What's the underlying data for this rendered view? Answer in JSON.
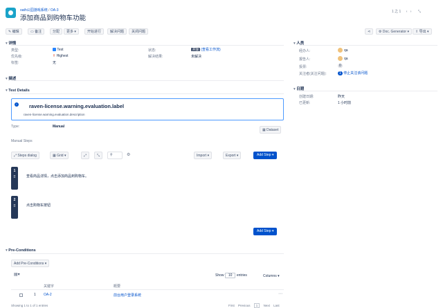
{
  "header": {
    "breadcrumb_project": "oath公园游戏系统",
    "breadcrumb_sep": "/",
    "breadcrumb_issue": "OA-3",
    "title": "添加商品到购物车功能",
    "pager": "1 之 1"
  },
  "toolbar": {
    "edit": "编辑",
    "comment": "备注",
    "assign": "分配",
    "more": "更多",
    "start": "开始进行",
    "resolve": "解决问题",
    "close": "关闭问题",
    "doc_generator": "Doc. Generator",
    "export": "导出"
  },
  "details": {
    "title": "详情",
    "type_label": "类型:",
    "type_value": "Test",
    "priority_label": "优先级:",
    "priority_value": "Highest",
    "tags_label": "标签:",
    "tags_value": "无",
    "status_label": "状态:",
    "status_value": "开放",
    "status_link": "(查看工作流)",
    "resolution_label": "解决结果:",
    "resolution_value": "未解决"
  },
  "description": {
    "title": "描述"
  },
  "test_details": {
    "title": "Test Details",
    "warning_title": "raven-license.warning.evaluation.label",
    "warning_desc": "raven-license.warning.evaluation.description",
    "type_label": "Type:",
    "type_value": "Manual",
    "dataset_button": "Dataset"
  },
  "manual_steps": {
    "title": "Manual Steps",
    "steps_dialog": "Steps dialog",
    "grid": "Grid",
    "import": "Import",
    "export": "Export",
    "add_step": "Add Step",
    "steps": [
      {
        "num": "1",
        "text": "查看商品详情，点击添加商品到购物车。"
      },
      {
        "num": "2",
        "text": "点击购物车按钮"
      }
    ]
  },
  "preconditions": {
    "title": "Pre-Conditions",
    "add_button": "Add Pre-Conditions",
    "show_label": "Show",
    "show_value": "10",
    "entries_label": "entries",
    "columns_button": "Columns",
    "col_key": "关键字",
    "col_summary": "概要",
    "rows": [
      {
        "index": "1",
        "key": "OA-2",
        "summary": "前台用户登录系统"
      }
    ],
    "footer_info": "Showing 1 to 1 of 1 entries",
    "first": "First",
    "previous": "Previous",
    "page": "1",
    "next": "Next",
    "last": "Last"
  },
  "people": {
    "title": "人员",
    "assignee_label": "经办人:",
    "assignee_value": "qa",
    "reporter_label": "报告人:",
    "reporter_value": "qa",
    "votes_label": "投票:",
    "votes_value": "0",
    "watchers_label": "关注者(关注问题):",
    "watchers_count": "1",
    "watchers_link": "停止关注该问题"
  },
  "dates": {
    "title": "日期",
    "created_label": "创建日期:",
    "created_value": "昨天",
    "updated_label": "已更新:",
    "updated_value": "1 小时前"
  }
}
